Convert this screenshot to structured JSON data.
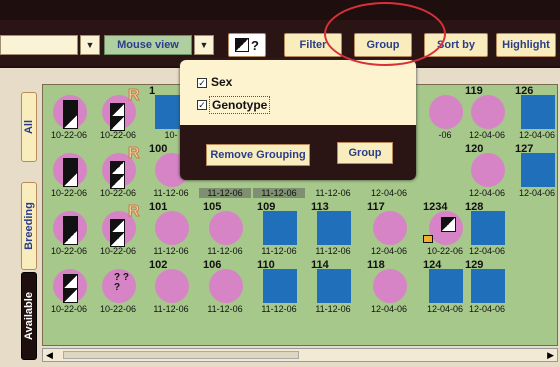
{
  "toolbar": {
    "view_select": "Mouse view",
    "dropdown_glyph": "▼",
    "question_mark": "?",
    "filter_label": "Filter",
    "group_label": "Group",
    "sortby_label": "Sort by",
    "highlight_label": "Highlight"
  },
  "side_tabs": {
    "all": "All",
    "breeding": "Breeding",
    "available": "Available"
  },
  "popup": {
    "sex_label": "Sex",
    "genotype_label": "Genotype",
    "checkmark": "✓",
    "remove_grouping_label": "Remove Grouping",
    "group_button_label": "Group"
  },
  "grid": {
    "rows": [
      [
        {
          "num": "",
          "shape": "circle",
          "date": "10-22-06",
          "glyph": "dg"
        },
        {
          "num": "",
          "shape": "circle",
          "date": "10-22-06",
          "glyph": "sexR"
        },
        {
          "num": "1",
          "shape": "square",
          "date": "10-",
          "glyph": ""
        },
        {
          "num": "",
          "shape": "none",
          "date": "",
          "glyph": ""
        },
        {
          "num": "",
          "shape": "none",
          "date": "",
          "glyph": ""
        },
        {
          "num": "",
          "shape": "none",
          "date": "",
          "glyph": ""
        },
        {
          "num": "",
          "shape": "none",
          "date": "",
          "glyph": ""
        },
        {
          "num": "",
          "shape": "circle",
          "date": "-06",
          "glyph": ""
        },
        {
          "num": "119",
          "shape": "circle",
          "date": "12-04-06",
          "glyph": ""
        },
        {
          "num": "126",
          "shape": "square",
          "date": "12-04-06",
          "glyph": ""
        }
      ],
      [
        {
          "num": "",
          "shape": "circle",
          "date": "10-22-06",
          "glyph": "dg"
        },
        {
          "num": "",
          "shape": "circle",
          "date": "10-22-06",
          "glyph": "sexR"
        },
        {
          "num": "100",
          "shape": "circle",
          "date": "11-12-06",
          "glyph": ""
        },
        {
          "num": "",
          "shape": "none",
          "date": "11-12-06",
          "glyph": "",
          "gray": true
        },
        {
          "num": "",
          "shape": "none",
          "date": "11-12-06",
          "glyph": "",
          "gray": true
        },
        {
          "num": "",
          "shape": "none",
          "date": "11-12-06",
          "glyph": ""
        },
        {
          "num": "",
          "shape": "none",
          "date": "12-04-06",
          "glyph": ""
        },
        {
          "num": "",
          "shape": "none",
          "date": "",
          "glyph": ""
        },
        {
          "num": "120",
          "shape": "circle",
          "date": "12-04-06",
          "glyph": ""
        },
        {
          "num": "127",
          "shape": "square",
          "date": "12-04-06",
          "glyph": ""
        }
      ],
      [
        {
          "num": "",
          "shape": "circle",
          "date": "10-22-06",
          "glyph": "dg"
        },
        {
          "num": "",
          "shape": "circle",
          "date": "10-22-06",
          "glyph": "sexR"
        },
        {
          "num": "101",
          "shape": "circle",
          "date": "11-12-06",
          "glyph": ""
        },
        {
          "num": "105",
          "shape": "circle",
          "date": "11-12-06",
          "glyph": ""
        },
        {
          "num": "109",
          "shape": "square",
          "date": "11-12-06",
          "glyph": ""
        },
        {
          "num": "113",
          "shape": "square",
          "date": "11-12-06",
          "glyph": ""
        },
        {
          "num": "117",
          "shape": "circle",
          "date": "12-04-06",
          "glyph": ""
        },
        {
          "num": "1234",
          "shape": "circle",
          "date": "10-22-06",
          "glyph": "flag"
        },
        {
          "num": "128",
          "shape": "square",
          "date": "12-04-06",
          "glyph": ""
        },
        {
          "num": "",
          "shape": "none",
          "date": "",
          "glyph": ""
        }
      ],
      [
        {
          "num": "",
          "shape": "circle",
          "date": "10-22-06",
          "glyph": "dg2"
        },
        {
          "num": "",
          "shape": "circle",
          "date": "10-22-06",
          "glyph": "qq"
        },
        {
          "num": "102",
          "shape": "circle",
          "date": "11-12-06",
          "glyph": ""
        },
        {
          "num": "106",
          "shape": "circle",
          "date": "11-12-06",
          "glyph": ""
        },
        {
          "num": "110",
          "shape": "square",
          "date": "11-12-06",
          "glyph": ""
        },
        {
          "num": "114",
          "shape": "square",
          "date": "11-12-06",
          "glyph": ""
        },
        {
          "num": "118",
          "shape": "circle",
          "date": "12-04-06",
          "glyph": ""
        },
        {
          "num": "124",
          "shape": "square",
          "date": "12-04-06",
          "glyph": ""
        },
        {
          "num": "129",
          "shape": "square",
          "date": "12-04-06",
          "glyph": ""
        },
        {
          "num": "",
          "shape": "none",
          "date": "",
          "glyph": ""
        }
      ]
    ]
  },
  "question_glyph": "? ?\n?"
}
